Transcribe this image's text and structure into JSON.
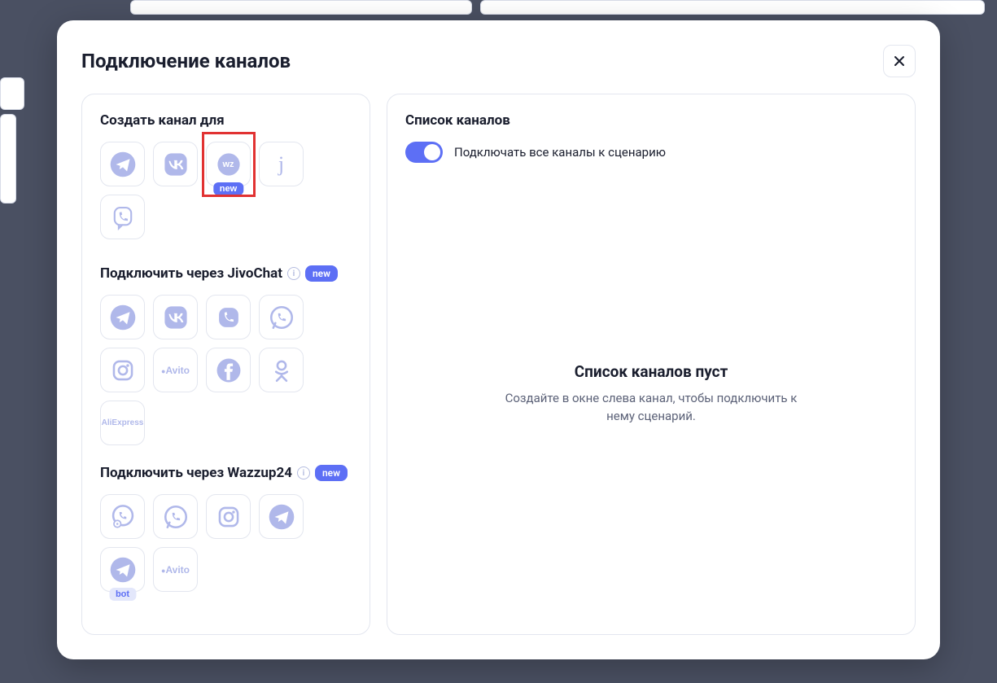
{
  "modal": {
    "title": "Подключение каналов"
  },
  "left": {
    "section1": {
      "title": "Создать канал для"
    },
    "section2": {
      "title": "Подключить через JivoChat",
      "badge": "new"
    },
    "section3": {
      "title": "Подключить через Wazzup24",
      "badge": "new"
    },
    "wz_new_badge": "new",
    "bot_badge": "bot",
    "avito_label": "Avito",
    "aliexpress_label": "AliExpress",
    "wz_label": "wz"
  },
  "right": {
    "title": "Список каналов",
    "toggle_label": "Подключать все каналы к сценарию",
    "empty_title": "Список каналов пуст",
    "empty_sub": "Создайте в окне слева канал, чтобы подключить к нему сценарий."
  }
}
